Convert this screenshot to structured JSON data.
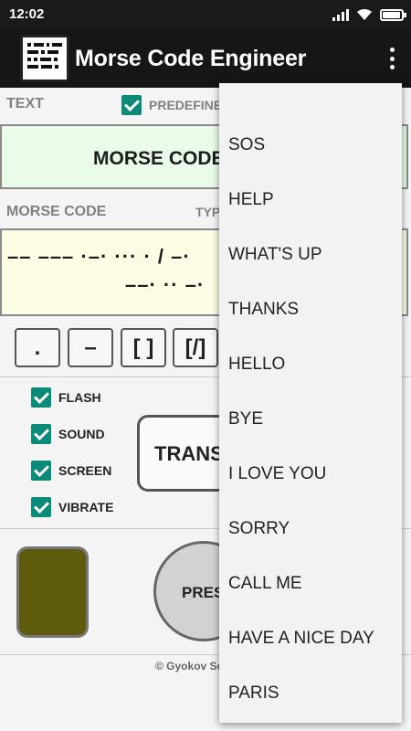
{
  "status": {
    "time": "12:02"
  },
  "appbar": {
    "title": "Morse Code Engineer",
    "menu_icon": "overflow-menu-icon"
  },
  "text_section": {
    "label": "TEXT",
    "predefined_label": "PREDEFINE",
    "predefined_checked": true,
    "value": "MORSE CODE"
  },
  "morse_section": {
    "label": "MORSE CODE",
    "type_label": "TYP",
    "line1": "–– ––– ·–· ··· · / –·",
    "line2": "––· ·· –·"
  },
  "keys": [
    ".",
    "–",
    "[ ]",
    "[/]"
  ],
  "options": [
    {
      "label": "FLASH",
      "checked": true
    },
    {
      "label": "SOUND",
      "checked": true
    },
    {
      "label": "SCREEN",
      "checked": true
    },
    {
      "label": "VIBRATE",
      "checked": true
    }
  ],
  "translate_label": "TRANS",
  "press_label": "PRES",
  "lamp_color": "#5e5c0c",
  "footer": "© Gyokov Sc",
  "menu": {
    "items": [
      "SOS",
      "HELP",
      "WHAT'S UP",
      "THANKS",
      "HELLO",
      "BYE",
      "I LOVE YOU",
      "SORRY",
      "CALL ME",
      "HAVE A NICE DAY",
      "PARIS"
    ]
  },
  "colors": {
    "accent": "#0b8a78",
    "appbar": "#161616",
    "text_bg": "#e9fce9",
    "morse_bg": "#fdfde6"
  }
}
